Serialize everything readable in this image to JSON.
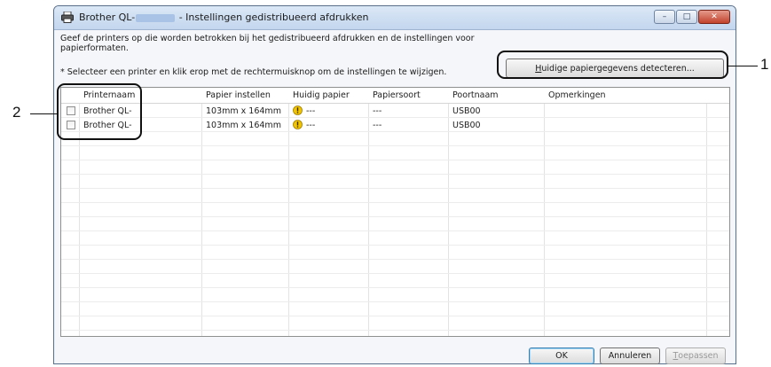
{
  "window": {
    "title_prefix": "Brother QL-",
    "title_suffix": " - Instellingen gedistribueerd afdrukken",
    "controls": {
      "minimize": "–",
      "maximize": "□",
      "close": "✕"
    }
  },
  "instructions": "Geef de printers op die worden betrokken bij het gedistribueerd afdrukken en de instellingen voor papierformaten.",
  "hint": "* Selecteer een printer en klik erop met de rechtermuisknop om de instellingen te wijzigen.",
  "detect_button": {
    "accesskey": "H",
    "rest": "uidige papiergegevens detecteren..."
  },
  "table": {
    "columns": [
      "Printernaam",
      "Papier instellen",
      "Huidig papier",
      "Papiersoort",
      "Poortnaam",
      "Opmerkingen"
    ],
    "rows": [
      {
        "checked": false,
        "printer": "Brother QL-",
        "paper_setting": "103mm x 164mm",
        "current_paper": "---",
        "paper_type": "---",
        "port": "USB00",
        "remarks": "",
        "warning_icon": "warning-icon"
      },
      {
        "checked": false,
        "printer": "Brother QL-",
        "paper_setting": "103mm x 164mm",
        "current_paper": "---",
        "paper_type": "---",
        "port": "USB00",
        "remarks": "",
        "warning_icon": "warning-icon"
      }
    ]
  },
  "buttons": {
    "ok": "OK",
    "cancel": "Annuleren",
    "apply": {
      "accesskey": "T",
      "rest": "oepassen"
    }
  },
  "callouts": {
    "one": "1",
    "two": "2"
  },
  "colors": {
    "warning": "#f2c500",
    "callout": "#111111",
    "titlebar": "#c3d6ee"
  }
}
